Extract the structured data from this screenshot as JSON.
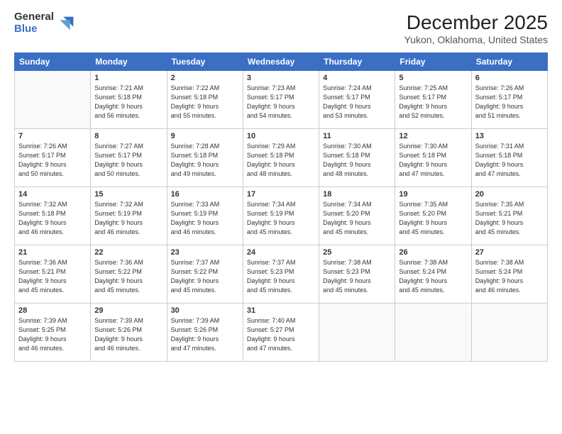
{
  "logo": {
    "general": "General",
    "blue": "Blue"
  },
  "title": "December 2025",
  "location": "Yukon, Oklahoma, United States",
  "days_of_week": [
    "Sunday",
    "Monday",
    "Tuesday",
    "Wednesday",
    "Thursday",
    "Friday",
    "Saturday"
  ],
  "weeks": [
    [
      {
        "num": "",
        "info": ""
      },
      {
        "num": "1",
        "info": "Sunrise: 7:21 AM\nSunset: 5:18 PM\nDaylight: 9 hours\nand 56 minutes."
      },
      {
        "num": "2",
        "info": "Sunrise: 7:22 AM\nSunset: 5:18 PM\nDaylight: 9 hours\nand 55 minutes."
      },
      {
        "num": "3",
        "info": "Sunrise: 7:23 AM\nSunset: 5:17 PM\nDaylight: 9 hours\nand 54 minutes."
      },
      {
        "num": "4",
        "info": "Sunrise: 7:24 AM\nSunset: 5:17 PM\nDaylight: 9 hours\nand 53 minutes."
      },
      {
        "num": "5",
        "info": "Sunrise: 7:25 AM\nSunset: 5:17 PM\nDaylight: 9 hours\nand 52 minutes."
      },
      {
        "num": "6",
        "info": "Sunrise: 7:26 AM\nSunset: 5:17 PM\nDaylight: 9 hours\nand 51 minutes."
      }
    ],
    [
      {
        "num": "7",
        "info": "Sunrise: 7:26 AM\nSunset: 5:17 PM\nDaylight: 9 hours\nand 50 minutes."
      },
      {
        "num": "8",
        "info": "Sunrise: 7:27 AM\nSunset: 5:17 PM\nDaylight: 9 hours\nand 50 minutes."
      },
      {
        "num": "9",
        "info": "Sunrise: 7:28 AM\nSunset: 5:18 PM\nDaylight: 9 hours\nand 49 minutes."
      },
      {
        "num": "10",
        "info": "Sunrise: 7:29 AM\nSunset: 5:18 PM\nDaylight: 9 hours\nand 48 minutes."
      },
      {
        "num": "11",
        "info": "Sunrise: 7:30 AM\nSunset: 5:18 PM\nDaylight: 9 hours\nand 48 minutes."
      },
      {
        "num": "12",
        "info": "Sunrise: 7:30 AM\nSunset: 5:18 PM\nDaylight: 9 hours\nand 47 minutes."
      },
      {
        "num": "13",
        "info": "Sunrise: 7:31 AM\nSunset: 5:18 PM\nDaylight: 9 hours\nand 47 minutes."
      }
    ],
    [
      {
        "num": "14",
        "info": "Sunrise: 7:32 AM\nSunset: 5:18 PM\nDaylight: 9 hours\nand 46 minutes."
      },
      {
        "num": "15",
        "info": "Sunrise: 7:32 AM\nSunset: 5:19 PM\nDaylight: 9 hours\nand 46 minutes."
      },
      {
        "num": "16",
        "info": "Sunrise: 7:33 AM\nSunset: 5:19 PM\nDaylight: 9 hours\nand 46 minutes."
      },
      {
        "num": "17",
        "info": "Sunrise: 7:34 AM\nSunset: 5:19 PM\nDaylight: 9 hours\nand 45 minutes."
      },
      {
        "num": "18",
        "info": "Sunrise: 7:34 AM\nSunset: 5:20 PM\nDaylight: 9 hours\nand 45 minutes."
      },
      {
        "num": "19",
        "info": "Sunrise: 7:35 AM\nSunset: 5:20 PM\nDaylight: 9 hours\nand 45 minutes."
      },
      {
        "num": "20",
        "info": "Sunrise: 7:35 AM\nSunset: 5:21 PM\nDaylight: 9 hours\nand 45 minutes."
      }
    ],
    [
      {
        "num": "21",
        "info": "Sunrise: 7:36 AM\nSunset: 5:21 PM\nDaylight: 9 hours\nand 45 minutes."
      },
      {
        "num": "22",
        "info": "Sunrise: 7:36 AM\nSunset: 5:22 PM\nDaylight: 9 hours\nand 45 minutes."
      },
      {
        "num": "23",
        "info": "Sunrise: 7:37 AM\nSunset: 5:22 PM\nDaylight: 9 hours\nand 45 minutes."
      },
      {
        "num": "24",
        "info": "Sunrise: 7:37 AM\nSunset: 5:23 PM\nDaylight: 9 hours\nand 45 minutes."
      },
      {
        "num": "25",
        "info": "Sunrise: 7:38 AM\nSunset: 5:23 PM\nDaylight: 9 hours\nand 45 minutes."
      },
      {
        "num": "26",
        "info": "Sunrise: 7:38 AM\nSunset: 5:24 PM\nDaylight: 9 hours\nand 45 minutes."
      },
      {
        "num": "27",
        "info": "Sunrise: 7:38 AM\nSunset: 5:24 PM\nDaylight: 9 hours\nand 46 minutes."
      }
    ],
    [
      {
        "num": "28",
        "info": "Sunrise: 7:39 AM\nSunset: 5:25 PM\nDaylight: 9 hours\nand 46 minutes."
      },
      {
        "num": "29",
        "info": "Sunrise: 7:39 AM\nSunset: 5:26 PM\nDaylight: 9 hours\nand 46 minutes."
      },
      {
        "num": "30",
        "info": "Sunrise: 7:39 AM\nSunset: 5:26 PM\nDaylight: 9 hours\nand 47 minutes."
      },
      {
        "num": "31",
        "info": "Sunrise: 7:40 AM\nSunset: 5:27 PM\nDaylight: 9 hours\nand 47 minutes."
      },
      {
        "num": "",
        "info": ""
      },
      {
        "num": "",
        "info": ""
      },
      {
        "num": "",
        "info": ""
      }
    ]
  ]
}
